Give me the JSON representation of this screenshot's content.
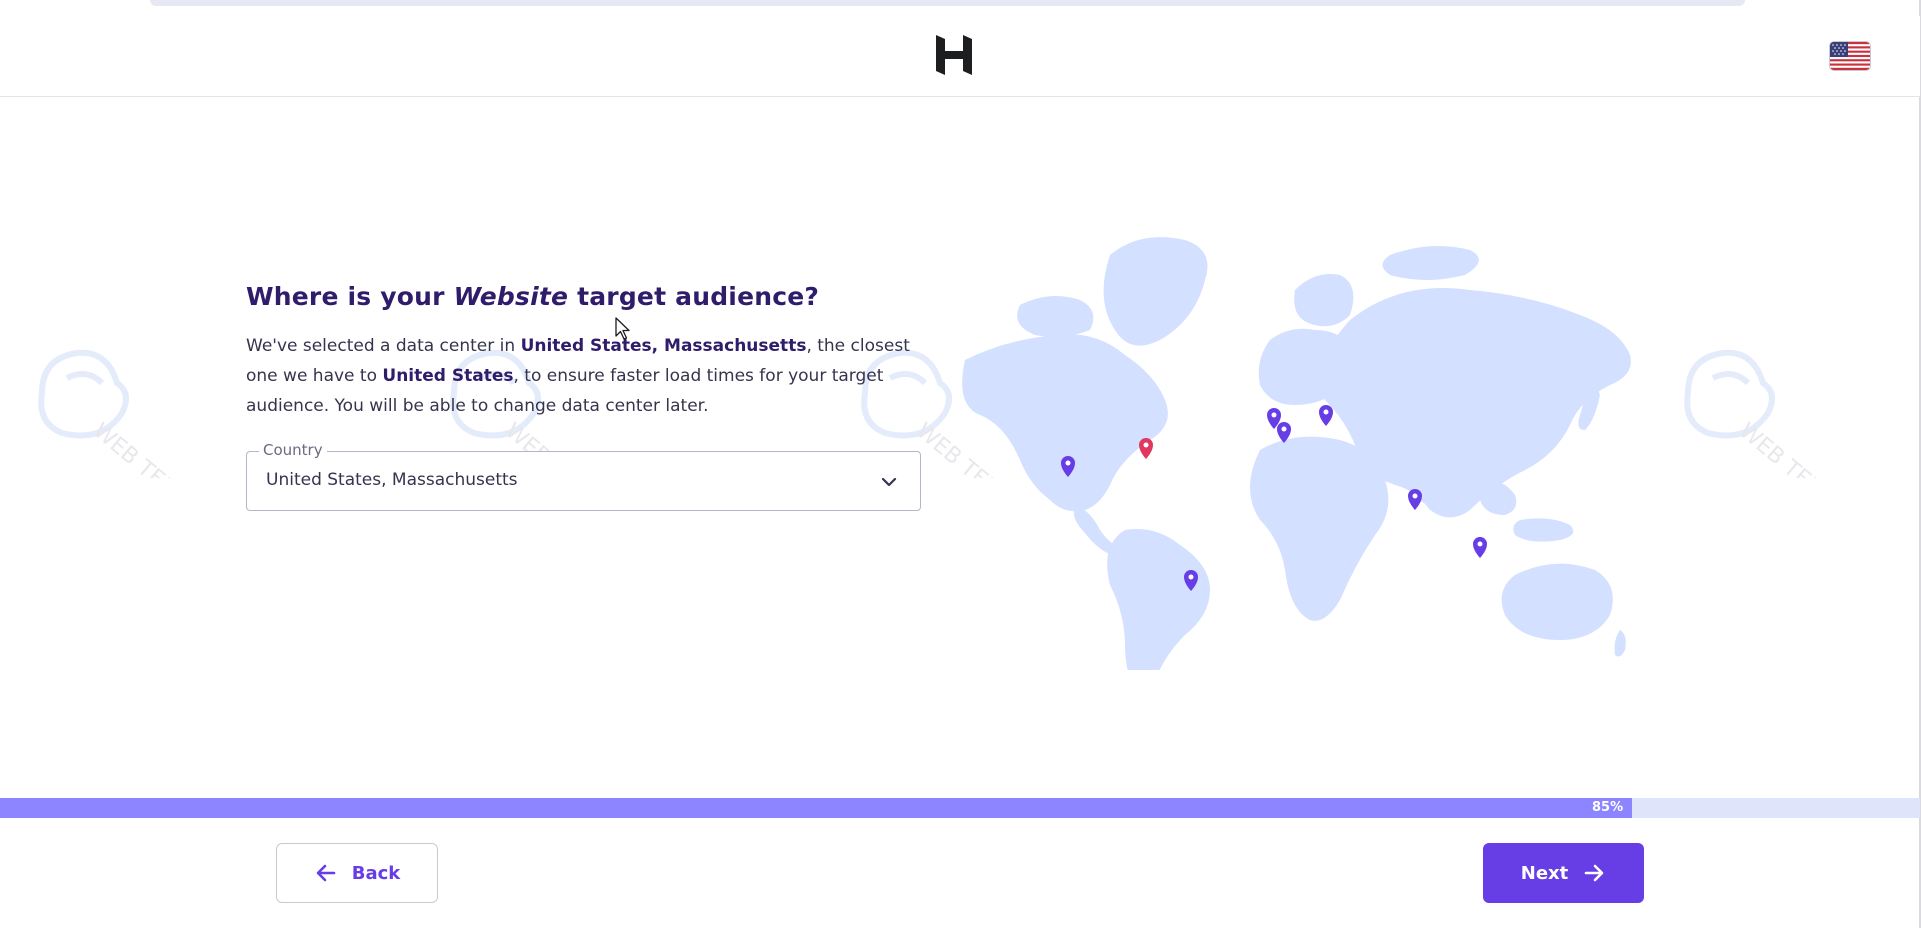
{
  "header": {
    "logo_icon": "hostinger-logo-icon",
    "language_flag_icon": "us-flag-icon"
  },
  "main": {
    "question_prefix": "Where is your",
    "question_emphasis": "Website",
    "question_suffix": "target audience?",
    "description": {
      "part1": "We've selected a data center in ",
      "bold1": "United States, Massachusetts",
      "part2": ", the closest one we have to ",
      "bold2": "United States",
      "part3": ", to ensure faster load times for your target audience. You will be able to change data center later."
    },
    "country_field": {
      "label": "Country",
      "value": "United States, Massachusetts",
      "icon": "chevron-down-icon"
    }
  },
  "map": {
    "land_color": "#d3e0ff",
    "pin_color": "#673de6",
    "selected_pin_color": "#e0385f"
  },
  "watermark": {
    "text": "WEB TEK"
  },
  "progress": {
    "value": 0.85,
    "label": "85%",
    "fill_color": "#8c85ff",
    "track_color": "#dfe4fb"
  },
  "footer": {
    "back_label": "Back",
    "back_icon": "arrow-left-icon",
    "next_label": "Next",
    "next_icon": "arrow-right-icon"
  },
  "colors": {
    "accent": "#673de6",
    "heading": "#2f1c6a"
  }
}
